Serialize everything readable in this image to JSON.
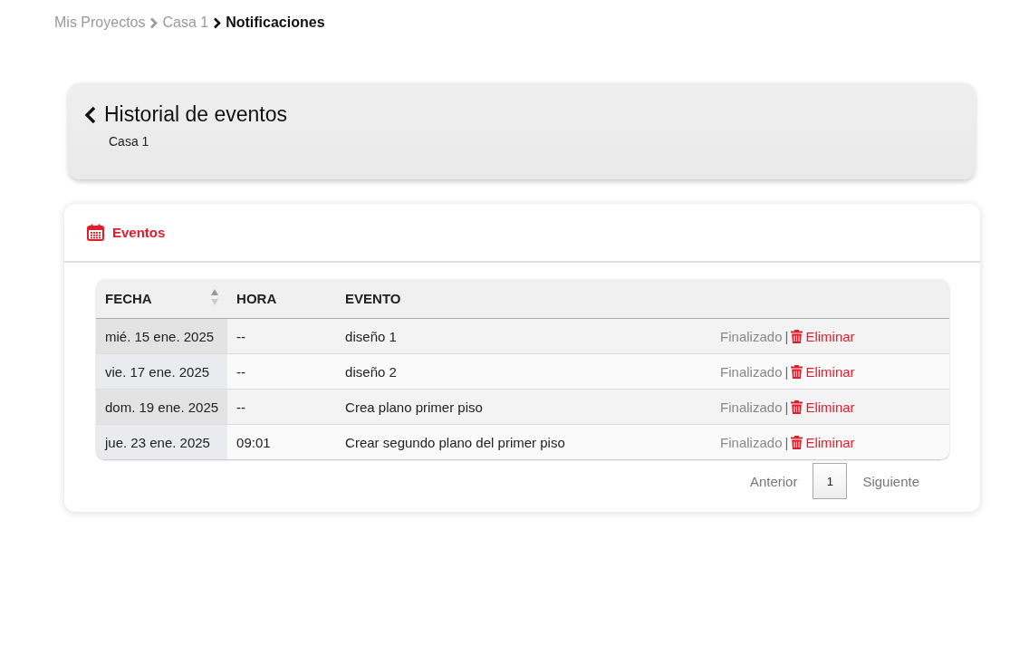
{
  "breadcrumb": {
    "items": [
      {
        "label": "Mis Proyectos",
        "current": false
      },
      {
        "label": "Casa 1",
        "current": false
      },
      {
        "label": "Notificaciones",
        "current": true
      }
    ]
  },
  "header": {
    "title": "Historial de eventos",
    "subtitle": "Casa 1"
  },
  "card": {
    "title": "Eventos"
  },
  "table": {
    "columns": [
      {
        "label": "FECHA",
        "sorted": true
      },
      {
        "label": "HORA",
        "sorted": false
      },
      {
        "label": "EVENTO",
        "sorted": false
      }
    ],
    "rows": [
      {
        "fecha": "mié. 15 ene. 2025",
        "hora": "--",
        "evento": "diseño 1",
        "status": "Finalizado",
        "separator": "|",
        "action": "Eliminar"
      },
      {
        "fecha": "vie. 17 ene. 2025",
        "hora": "--",
        "evento": "diseño 2",
        "status": "Finalizado",
        "separator": "|",
        "action": "Eliminar"
      },
      {
        "fecha": "dom. 19 ene. 2025",
        "hora": "--",
        "evento": "Crea plano primer piso",
        "status": "Finalizado",
        "separator": "|",
        "action": "Eliminar"
      },
      {
        "fecha": "jue. 23 ene. 2025",
        "hora": "09:01",
        "evento": "Crear segundo plano del primer piso",
        "status": "Finalizado",
        "separator": "|",
        "action": "Eliminar"
      }
    ]
  },
  "pagination": {
    "previous": "Anterior",
    "pages": [
      {
        "label": "1",
        "selected": true
      }
    ],
    "next": "Siguiente"
  }
}
